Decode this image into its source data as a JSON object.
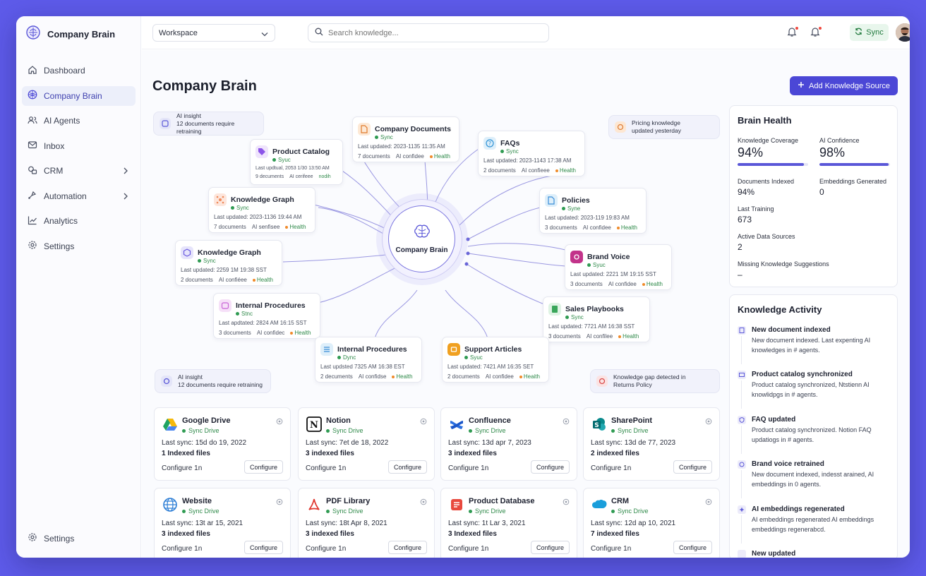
{
  "brand": {
    "name": "Company Brain"
  },
  "sidebar": {
    "items": [
      {
        "label": "Dashboard",
        "icon": "home-icon"
      },
      {
        "label": "Company Brain",
        "icon": "brain-icon",
        "active": true
      },
      {
        "label": "AI Agents",
        "icon": "users-icon"
      },
      {
        "label": "Inbox",
        "icon": "mail-icon"
      },
      {
        "label": "CRM",
        "icon": "crm-icon",
        "chevron": true
      },
      {
        "label": "Automation",
        "icon": "automation-icon",
        "chevron": true
      },
      {
        "label": "Analytics",
        "icon": "analytics-icon"
      },
      {
        "label": "Settings",
        "icon": "gear-icon"
      }
    ],
    "footer_label": "Settings"
  },
  "topbar": {
    "workspace": "Workspace",
    "search_placeholder": "Search knowledge...",
    "sync_label": "Sync"
  },
  "page": {
    "title": "Company Brain",
    "add_button": "Add Knowledge Source"
  },
  "graph": {
    "hub_label": "Company Brain",
    "nodes": [
      {
        "id": "company-documents",
        "name": "Company Documents",
        "status": "Sync",
        "updated": "Last updated: 2023-1135 11:35 AM",
        "docs": "7 documents",
        "conf": "AI confidee",
        "health": "Health",
        "icon": "document-icon",
        "color": "#f59a44"
      },
      {
        "id": "faqs",
        "name": "FAQs",
        "status": "Sync",
        "updated": "Last updated: 2023-1143 17:38 AM",
        "docs": "2 documents",
        "conf": "AI confieee",
        "health": "Health",
        "icon": "question-icon",
        "color": "#2f93d6"
      },
      {
        "id": "product-catalog",
        "name": "Product Catalog",
        "status": "Syuc",
        "updated": "Last updtual, 2053 1/30 13:50 AM",
        "docs": "9 decuments",
        "conf": "AI cerifeee",
        "health": "nodih",
        "icon": "tag-icon",
        "color": "#8c54e8"
      },
      {
        "id": "knowledge-graph-1",
        "name": "Knowledge Graph",
        "status": "Sync",
        "updated": "Last updated: 2023-1136 19:44 AM",
        "docs": "7 documents",
        "conf": "AI senfisee",
        "health": "Health",
        "icon": "graph-icon",
        "color": "#f08a5a"
      },
      {
        "id": "policies",
        "name": "Policies",
        "status": "Syne",
        "updated": "Last updated: 2023-119 19:83 AM",
        "docs": "3 documents",
        "conf": "AI confidee",
        "health": "Health",
        "icon": "file-icon",
        "color": "#3a8ed8"
      },
      {
        "id": "knowledge-graph-2",
        "name": "Knowledge Graph",
        "status": "Sync",
        "updated": "Last updated: 2259 1M 19:38 SST",
        "docs": "2 documents",
        "conf": "AI confiéee",
        "health": "Health",
        "icon": "graph-icon",
        "color": "#6a5ae0"
      },
      {
        "id": "brand-voice",
        "name": "Brand Voice",
        "status": "Syuc",
        "updated": "Last updated: 2221 1M 19:15 SST",
        "docs": "3 documents",
        "conf": "AI confidee",
        "health": "Health",
        "icon": "voice-icon",
        "color": "#c2338a"
      },
      {
        "id": "internal-procedures-1",
        "name": "Internal Procedures",
        "status": "Stnc",
        "updated": "Last apdtated: 2824 AM 16:15 SST",
        "docs": "3 documents",
        "conf": "AI confidec",
        "health": "Health",
        "icon": "procedure-icon",
        "color": "#c864d6"
      },
      {
        "id": "sales-playbooks",
        "name": "Sales Playbooks",
        "status": "Sync",
        "updated": "Last updated: 7721 AM 16:38 SST",
        "docs": "3 documents",
        "conf": "AI confilee",
        "health": "Health",
        "icon": "playbook-icon",
        "color": "#3aa65a"
      },
      {
        "id": "internal-procedures-2",
        "name": "Internal Procedures",
        "status": "Dync",
        "updated": "Last updsted 7325 AM 16:38 EST",
        "docs": "2 decuments",
        "conf": "AI confidse",
        "health": "Health",
        "icon": "list-icon",
        "color": "#3a8ed8"
      },
      {
        "id": "support-articles",
        "name": "Support Articles",
        "status": "Syuc",
        "updated": "Last updated: 7421 AM 16:35 SET",
        "docs": "2 documents",
        "conf": "AI confidee",
        "health": "Heaith",
        "icon": "support-icon",
        "color": "#f0a020"
      }
    ],
    "pills": [
      {
        "id": "insight-1",
        "line1": "AI insight",
        "line2": "12 documents require retraining"
      },
      {
        "id": "pricing",
        "line1": "Pricing knowledge",
        "line2": "updated yesterday"
      },
      {
        "id": "insight-2",
        "line1": "AI insight",
        "line2": "12 documents require retraining"
      },
      {
        "id": "gap",
        "line1": "Knowledge gap detected in",
        "line2": "Returns Policy"
      }
    ]
  },
  "health": {
    "title": "Brain Health",
    "coverage_label": "Knowledge Coverage",
    "coverage_value": "94%",
    "coverage_fraction": 0.94,
    "confidence_label": "AI Confidence",
    "confidence_value": "98%",
    "confidence_fraction": 0.98,
    "docs_indexed_label": "Documents Indexed",
    "docs_indexed_value": "94%",
    "embeddings_label": "Embeddings Generated",
    "embeddings_value": "0",
    "training_label": "Last Training",
    "training_value": "673",
    "sources_label": "Active Data Sources",
    "sources_value": "2",
    "missing_label": "Missing Knowledge Suggestions",
    "missing_value": "–"
  },
  "activity": {
    "title": "Knowledge Activity",
    "items": [
      {
        "title": "New document indexed",
        "line1": "New document indexed. Last expenting AI",
        "line2": "knowledges in # agents."
      },
      {
        "title": "Product catalog synchronized",
        "line1": "Product catalog synchronized, Ntstienn AI",
        "line2": "knowlidpgs in # agents."
      },
      {
        "title": "FAQ updated",
        "line1": "Product catalog synchronized. Notion FAQ",
        "line2": "updatiogs in # agents."
      },
      {
        "title": "Brand voice retrained",
        "line1": "New document indexed, indesst arained, AI",
        "line2": "embeddings in 0 agents."
      },
      {
        "title": "AI embeddings regenerated",
        "line1": "AI embeddings regenerated AI embeddings",
        "line2": "embeddings regenerabcd."
      },
      {
        "title": "New updated",
        "line1": "",
        "line2": ""
      }
    ]
  },
  "sources": [
    {
      "name": "Google Drive",
      "status": "Sync Drive",
      "last_sync": "Last sync: 15d do 19, 2022",
      "files": "1 Indexed files",
      "configure_label": "Configure 1n",
      "button": "Configure",
      "icon": "google-drive-icon"
    },
    {
      "name": "Notion",
      "status": "Sync Drive",
      "last_sync": "Last sync: 7et de 18, 2022",
      "files": "3 indexed files",
      "configure_label": "Configure 1n",
      "button": "Configure",
      "icon": "notion-icon"
    },
    {
      "name": "Confluence",
      "status": "Sync Drive",
      "last_sync": "Last sync: 13d apr 7, 2023",
      "files": "3 indexed files",
      "configure_label": "Configure 1n",
      "button": "Configure",
      "icon": "confluence-icon"
    },
    {
      "name": "SharePoint",
      "status": "Sync Drive",
      "last_sync": "Last sync: 13d de 77, 2023",
      "files": "2 indexed files",
      "configure_label": "Configure 1n",
      "button": "Configure",
      "icon": "sharepoint-icon"
    },
    {
      "name": "Website",
      "status": "Sync Drive",
      "last_sync": "Last sync: 13t ar 15, 2021",
      "files": "3 indexed files",
      "configure_label": "Configure 1n",
      "button": "Configure",
      "icon": "globe-icon"
    },
    {
      "name": "PDF Library",
      "status": "Sync Drive",
      "last_sync": "Last sync: 18t Apr 8, 2021",
      "files": "3 indexed files",
      "configure_label": "Configure 1n",
      "button": "Configure",
      "icon": "pdf-icon"
    },
    {
      "name": "Product Database",
      "status": "Sync Drive",
      "last_sync": "Last sync: 1t Lar 3, 2021",
      "files": "3 Indexed files",
      "configure_label": "Configure 1n",
      "button": "Configure",
      "icon": "database-icon"
    },
    {
      "name": "CRM",
      "status": "Sync Drive",
      "last_sync": "Last sync: 12d ap 10, 2021",
      "files": "7 indexed files",
      "configure_label": "Configure 1n",
      "button": "Configure",
      "icon": "salesforce-icon"
    }
  ]
}
